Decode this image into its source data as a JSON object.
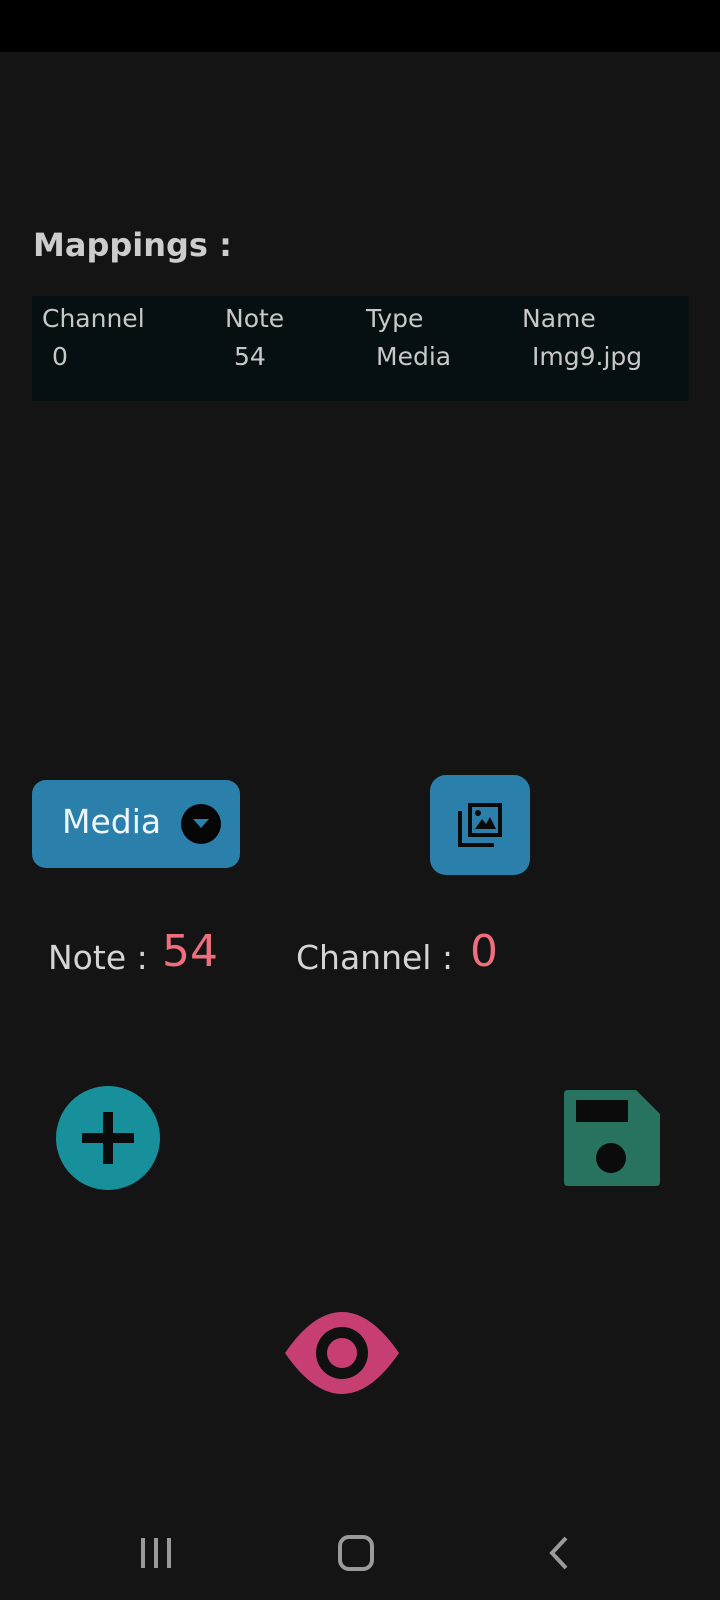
{
  "mappings": {
    "title": "Mappings :",
    "columns": [
      "Channel",
      "Note",
      "Type",
      "Name"
    ],
    "rows": [
      [
        "0",
        "54",
        "Media",
        "Img9.jpg"
      ]
    ]
  },
  "controls": {
    "type_select": {
      "selected": "Media",
      "icon": "dropdown-arrow-icon"
    },
    "gallery_button": {
      "icon": "photo-library-icon"
    },
    "note_label": "Note :",
    "note_value": "54",
    "channel_label": "Channel :",
    "channel_value": "0",
    "add_button": {
      "icon": "plus-icon"
    },
    "save_button": {
      "icon": "floppy-disk-icon"
    },
    "preview_button": {
      "icon": "eye-icon"
    }
  },
  "navigation": {
    "recents": {
      "icon": "recent-apps-icon"
    },
    "home": {
      "icon": "home-icon"
    },
    "back": {
      "icon": "back-icon"
    }
  },
  "colors": {
    "background": "#141414",
    "table_background": "#061012",
    "accent_blue": "#2b7fab",
    "add_teal": "#17909c",
    "save_green": "#27735f",
    "eye_pink": "#c73f72",
    "value_red": "#ef6e7d"
  }
}
